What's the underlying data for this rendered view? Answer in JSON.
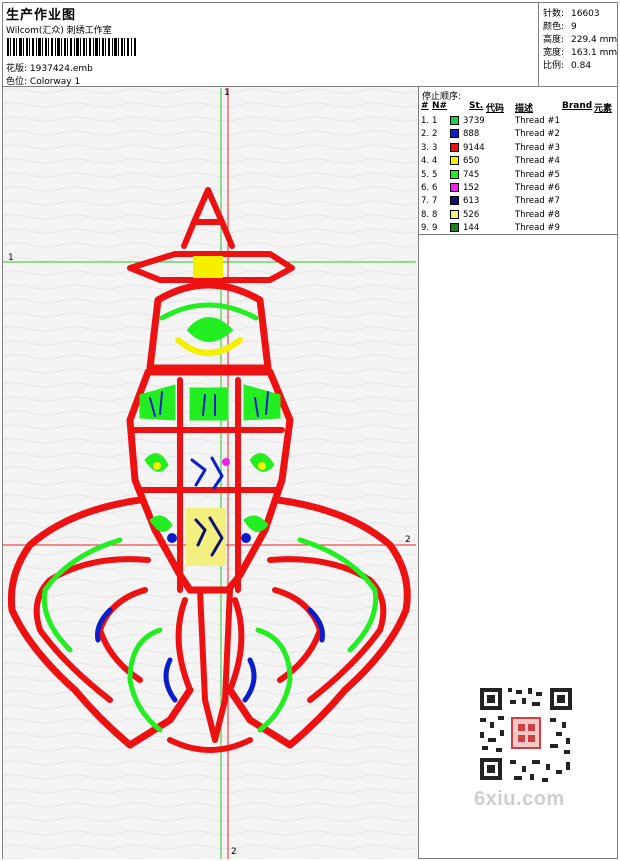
{
  "header": {
    "title": "生产作业图",
    "studio": "Wilcom(汇众) 刺绣工作室",
    "design_label": "花版:",
    "design_file": "1937424.emb",
    "colorway_label": "色位:",
    "colorway": "Colorway 1"
  },
  "stats": [
    {
      "label": "针数:",
      "value": "16603"
    },
    {
      "label": "颜色:",
      "value": "9"
    },
    {
      "label": "高度:",
      "value": "229.4 mm"
    },
    {
      "label": "宽度:",
      "value": "163.1 mm"
    },
    {
      "label": "比例:",
      "value": "0.84"
    }
  ],
  "stop_sequence": {
    "title": "停止顺序:",
    "columns": [
      "#",
      "N#",
      "St.",
      "代码",
      "描述",
      "Brand",
      "元素"
    ],
    "rows": [
      {
        "n": "1.",
        "c": "1",
        "code": "3739",
        "desc": "Thread #1",
        "color": "#22cc44"
      },
      {
        "n": "2.",
        "c": "2",
        "code": "888",
        "desc": "Thread #2",
        "color": "#0a1ecc"
      },
      {
        "n": "3.",
        "c": "3",
        "code": "9144",
        "desc": "Thread #3",
        "color": "#ee1111"
      },
      {
        "n": "4.",
        "c": "4",
        "code": "650",
        "desc": "Thread #4",
        "color": "#f6f000"
      },
      {
        "n": "5.",
        "c": "5",
        "code": "745",
        "desc": "Thread #5",
        "color": "#22ee22"
      },
      {
        "n": "6.",
        "c": "6",
        "code": "152",
        "desc": "Thread #6",
        "color": "#ee22ee"
      },
      {
        "n": "7.",
        "c": "7",
        "code": "613",
        "desc": "Thread #7",
        "color": "#101070"
      },
      {
        "n": "8.",
        "c": "8",
        "code": "526",
        "desc": "Thread #8",
        "color": "#f4f080"
      },
      {
        "n": "9.",
        "c": "9",
        "code": "144",
        "desc": "Thread #9",
        "color": "#208020"
      }
    ]
  },
  "guides": {
    "h1": "1",
    "v1": "1",
    "h2": "2",
    "v2": "2"
  },
  "watermark": "6xiu.com"
}
